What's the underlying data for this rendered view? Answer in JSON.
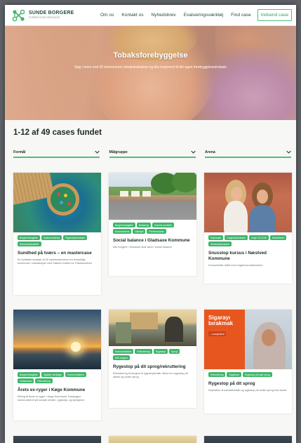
{
  "header": {
    "logo_title": "SUNDE BORGERE",
    "logo_subtitle": "FOREBYGGELSESGUIDE",
    "nav": [
      "Om os",
      "Kontakt os",
      "Nyhedsbrev",
      "Evalueringsværktøj",
      "Find case"
    ],
    "cta": "Indsend case"
  },
  "hero": {
    "title": "Tobaksforebyggelse",
    "subtitle": "Søg i mere end 40 kommuners tobaksindsatser og bliv inspireret til din egen forebyggelsesindsats"
  },
  "results": {
    "title": "1-12 af 49 cases fundet"
  },
  "filters": [
    "Formål",
    "Målgruppe",
    "Arena"
  ],
  "cards": [
    {
      "tags": [
        "Borgerindragelse",
        "Implementering",
        "Rygestopindsatser",
        "Samarbejdsaftaler"
      ],
      "title": "Sundhed på tværs – en mastercase",
      "desc": "En kvalitativ analyse af 40 casebeskrivelser fra forskellige kommuner i samarbejde med Statens Institut for Folkesundhed"
    },
    {
      "tags": [
        "Borgerindragelse",
        "Bolsaring",
        "Grønne områder",
        "Kommunerne",
        "Samspil",
        "Partnerskaber"
      ],
      "title": "Social balance i Gladsaxe Kommune",
      "desc": "Alle borgere i Gladsaxe skal være i social balance"
    },
    {
      "tags": [
        "Gymnasie",
        "Ungeuddannelser",
        "Unge 15-24 år",
        "Skoleelever",
        "Skoleuddannelser"
      ],
      "title": "Snusstop kursus i Næstved Kommune",
      "desc": "Kursusforløb rettet mod ungdomsuddannelser"
    },
    {
      "tags": [
        "Borgerindragelse",
        "Digitale værktøjer",
        "Kommunikation",
        "Fællesskab",
        "Rekruttering"
      ],
      "title": "Årets ex-ryger i Køge Kommune",
      "desc": "Kåring af årets ex-ryger i Køge Kommune. Kampagne kommunikeret på sociale medier, rygestop, og synlighed."
    },
    {
      "tags": [
        "Kommunikation",
        "Rekruttering",
        "Rygestop",
        "Sprog",
        "Alle borgere"
      ],
      "title": "Rygestop på dit sprog/rekruttering",
      "desc": "Rekruttering af borgere til rygestopforløb, tilbud om rygestop på dansk og andre sprog"
    },
    {
      "tags": [
        "Rekruttering",
        "Rygestop",
        "Rygestop på eget sprog"
      ],
      "title": "Rygestop på dit sprog",
      "desc": "Inspiration til samtaleforløb og rygestop på andre sprog end dansk"
    }
  ],
  "poster": {
    "headline": "Sigarayı bırakmak",
    "sub": "– kolaylıkla!"
  },
  "colors": {
    "accent": "#3fb66b",
    "brand": "#1f4e3d",
    "poster_orange": "#e8561f"
  }
}
